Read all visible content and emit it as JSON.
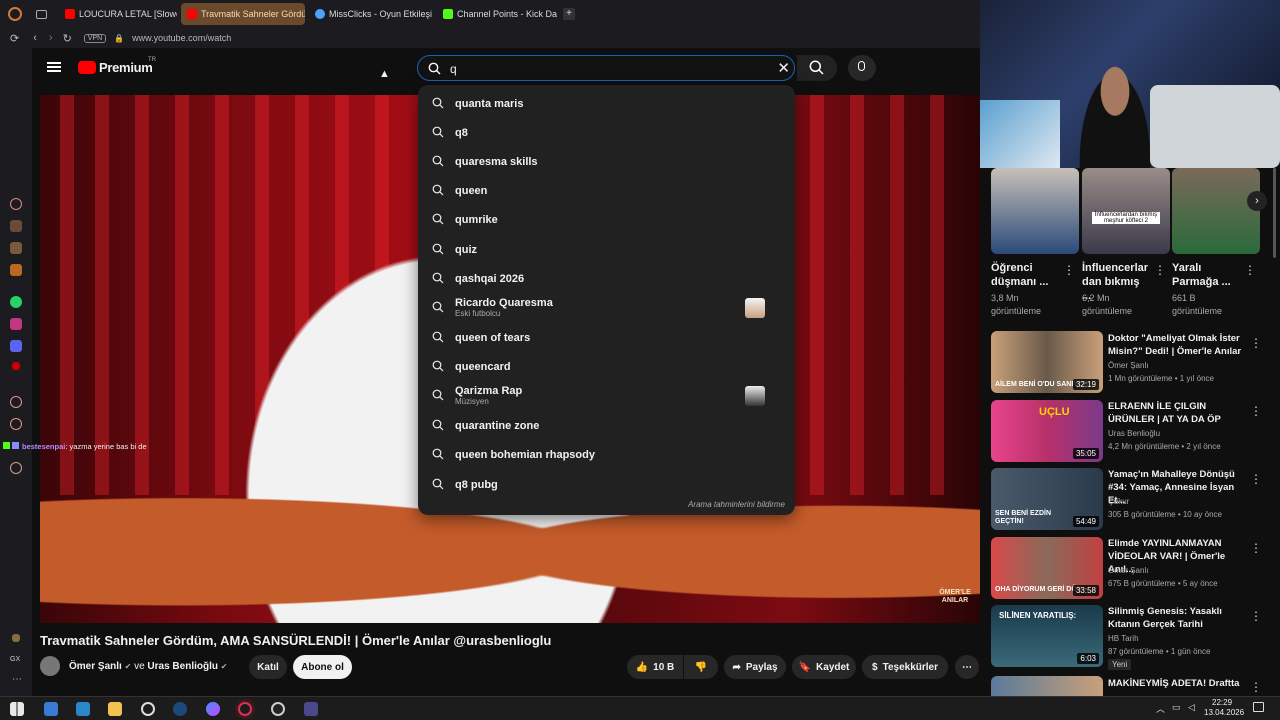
{
  "tabs": [
    {
      "label": "LOUCURA LETAL [Slowed]",
      "color": "#ff0000"
    },
    {
      "label": "Travmatik Sahneler Gördü",
      "color": "#ff0000"
    },
    {
      "label": "MissClicks - Oyun Etkileşi",
      "color": "#4aa3ff"
    },
    {
      "label": "Channel Points - Kick Das",
      "color": "#53fc18"
    }
  ],
  "address": {
    "vpn": "VPN",
    "url": "www.youtube.com/watch"
  },
  "header": {
    "logo": "Premium",
    "region": "TR"
  },
  "search": {
    "value": "q",
    "suggestions": [
      {
        "text": "quanta maris"
      },
      {
        "text": "q8"
      },
      {
        "text": "quaresma skills"
      },
      {
        "text": "queen"
      },
      {
        "text": "qumrike"
      },
      {
        "text": "quiz"
      },
      {
        "text": "qashqai 2026"
      },
      {
        "text": "Ricardo Quaresma",
        "sub": "Eski futbolcu"
      },
      {
        "text": "queen of tears"
      },
      {
        "text": "queencard"
      },
      {
        "text": "Qarizma Rap",
        "sub": "Müzisyen"
      },
      {
        "text": "quarantine zone"
      },
      {
        "text": "queen bohemian rhapsody"
      },
      {
        "text": "q8 pubg"
      }
    ],
    "report": "Arama tahminlerini bildirme"
  },
  "video": {
    "title": "Travmatik Sahneler Gördüm, AMA SANSÜRLENDİ! | Ömer'le Anılar @urasbenlioglu",
    "channel": "Ömer Şanlı",
    "and": "ve",
    "channel2": "Uras Benlioğlu",
    "join": "Katıl",
    "subscribe": "Abone ol",
    "likes": "10 B",
    "share": "Paylaş",
    "save": "Kaydet",
    "thanks": "Teşekkürler",
    "watermark": "ÖMER'LE ANILAR"
  },
  "chat": {
    "user": "bestesenpai",
    "message": ": yazma yerine bas bi de"
  },
  "shorts": [
    {
      "title": "Öğrenci düşmanı ...",
      "views": "3,8 Mn görüntüleme"
    },
    {
      "title": "İnfluencerlar dan bıkmış ...",
      "views": "6,2 Mn görüntüleme",
      "caption": "İnfluencerlardan bıkmış meşhur köfteci 2"
    },
    {
      "title": "Yaralı Parmağa ...",
      "views": "661 B görüntüleme"
    }
  ],
  "related": [
    {
      "title": "Doktor \"Ameliyat Olmak İster Misin?\" Dedi! | Ömer'le Anılar",
      "channel": "Ömer Şanlı",
      "meta": "1 Mn görüntüleme • 1 yıl önce",
      "duration": "32:19",
      "thumb_text": "AİLEM BENİ O'DU SANIYOR!"
    },
    {
      "title": "ELRAENN İLE ÇILGIN ÜRÜNLER | AT YA DA ÖP",
      "channel": "Uras Benlioğlu",
      "meta": "4,2 Mn görüntüleme • 2 yıl önce",
      "duration": "35:05",
      "thumb_text": "UÇLU"
    },
    {
      "title": "Yamaç'ın Mahalleye Dönüşü #34: Yamaç, Annesine İsyan Et...",
      "channel": "Çukur",
      "meta": "305 B görüntüleme • 10 ay önce",
      "duration": "54:49",
      "thumb_text": "SEN BENİ EZDİN GEÇTİN!"
    },
    {
      "title": "Elimde YAYINLANMAYAN VİDEOLAR VAR! | Ömer'le Anıl...",
      "channel": "Ömer Şanlı",
      "meta": "675 B görüntüleme • 5 ay önce",
      "duration": "33:58",
      "thumb_text": "OHA DİYORUM GERİ DÖN"
    },
    {
      "title": "Silinmiş Genesis: Yasaklı Kıtanın Gerçek Tarihi",
      "channel": "HB Tarih",
      "meta": "87 görüntüleme • 1 gün önce",
      "duration": "6:03",
      "badge": "Yeni",
      "thumb_text": "SİLİNEN YARATILIŞ:"
    },
    {
      "title": "MAKİNEYMİŞ ADETA! Draftta",
      "channel": "",
      "meta": "",
      "duration": "",
      "thumb_text": ""
    }
  ],
  "taskbar": {
    "time": "22:29",
    "date": "13.04.2026"
  }
}
